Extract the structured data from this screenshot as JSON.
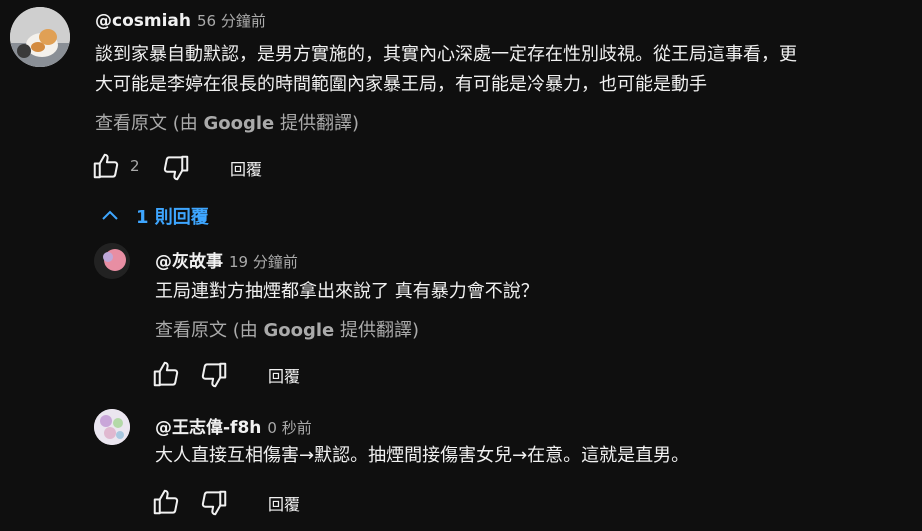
{
  "comment": {
    "author": "@cosmiah",
    "time": "56 分鐘前",
    "text_line1": "談到家暴自動默認，是男方實施的，其實內心深處一定存在性別歧視。從王局這事看，更",
    "text_line2": "大可能是李婷在很長的時間範圍內家暴王局，有可能是冷暴力，也可能是動手",
    "translate_prefix": "查看原文 (由 ",
    "translate_brand": "Google",
    "translate_suffix": " 提供翻譯)",
    "like_count": "2",
    "reply_label": "回覆",
    "avatar_icon": "cat-avatar"
  },
  "replies_toggle": {
    "label": "1 則回覆",
    "icon": "chevron-up-icon"
  },
  "replies": [
    {
      "author": "@灰故事",
      "time": "19 分鐘前",
      "text": "王局連對方抽煙都拿出來說了 真有暴力會不說？",
      "translate_prefix": "查看原文 (由 ",
      "translate_brand": "Google",
      "translate_suffix": " 提供翻譯)",
      "reply_label": "回覆"
    },
    {
      "author": "@王志偉-f8h",
      "time": "0 秒前",
      "text": "大人直接互相傷害→默認。抽煙間接傷害女兒→在意。這就是直男。",
      "reply_label": "回覆"
    }
  ],
  "colors": {
    "background": "#0f0f0f",
    "text": "#f1f1f1",
    "muted": "#aaaaaa",
    "link": "#3ea6ff"
  }
}
